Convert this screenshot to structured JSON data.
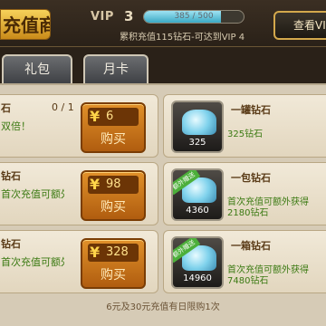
{
  "header": {
    "title": "充值商店",
    "vip_label": "VIP",
    "vip_level": "3",
    "vip_progress_text": "385 / 500",
    "vip_progress": 0.77,
    "vip_hint": "累积充值115钻石-可达到VIP 4",
    "view_vip_label": "查看VIP"
  },
  "tabs": [
    {
      "label": ""
    },
    {
      "label": "礼包"
    },
    {
      "label": "月卡"
    }
  ],
  "left_items": [
    {
      "name": "石",
      "count": "0 / 1",
      "desc": "双倍！",
      "price": "6",
      "buy": "购买"
    },
    {
      "name": "钻石",
      "count": "",
      "desc": "首次充值可额外获得",
      "price": "98",
      "buy": "购买"
    },
    {
      "name": "钻石",
      "count": "",
      "desc": "首次充值可额外获得",
      "price": "328",
      "buy": "购买"
    }
  ],
  "right_items": [
    {
      "name": "一罐钻石",
      "amount": "325",
      "desc": "325钻石",
      "desc2": "",
      "bonus": ""
    },
    {
      "name": "一包钻石",
      "amount": "4360",
      "desc": "首次充值可额外获得",
      "desc2": "2180钻石",
      "bonus": "额外赠送"
    },
    {
      "name": "一箱钻石",
      "amount": "14960",
      "desc": "首次充值可额外获得",
      "desc2": "7480钻石",
      "bonus": "额外赠送"
    }
  ],
  "footer": {
    "note": "6元及30元充值有日限购1次"
  }
}
